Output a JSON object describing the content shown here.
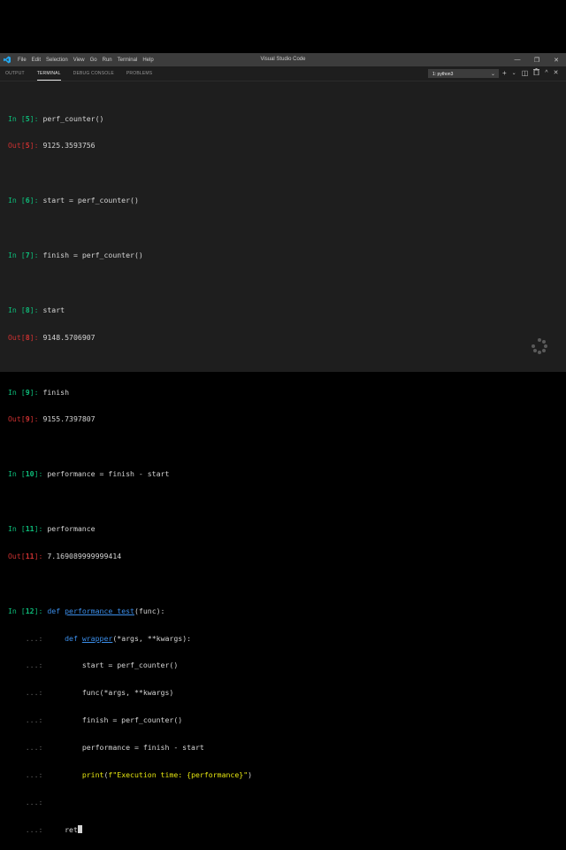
{
  "menu": [
    "File",
    "Edit",
    "Selection",
    "View",
    "Go",
    "Run",
    "Terminal",
    "Help"
  ],
  "app_title": "Visual Studio Code",
  "window_controls": {
    "minimize": "—",
    "restore": "❐",
    "close": "✕"
  },
  "panel_tabs": [
    {
      "label": "OUTPUT",
      "active": false
    },
    {
      "label": "TERMINAL",
      "active": true
    },
    {
      "label": "DEBUG CONSOLE",
      "active": false
    },
    {
      "label": "PROBLEMS",
      "active": false
    }
  ],
  "terminal_select": "1: python3",
  "panel_icons": [
    "plus-icon",
    "split-icon",
    "trash-icon",
    "chevron-up-icon",
    "close-icon"
  ],
  "terminal": {
    "l1_prompt": "In [",
    "l1_num": "5",
    "l1_end": "]: ",
    "l1_code": "perf_counter()",
    "o1_prompt": "Out[",
    "o1_num": "5",
    "o1_end": "]: ",
    "o1_val": "9125.3593756",
    "l2_prompt": "In [",
    "l2_num": "6",
    "l2_end": "]: ",
    "l2_code": "start = perf_counter()",
    "l3_prompt": "In [",
    "l3_num": "7",
    "l3_end": "]: ",
    "l3_code": "finish = perf_counter()",
    "l4_prompt": "In [",
    "l4_num": "8",
    "l4_end": "]: ",
    "l4_code": "start",
    "o4_prompt": "Out[",
    "o4_num": "8",
    "o4_end": "]: ",
    "o4_val": "9148.5706907",
    "l5_prompt": "In [",
    "l5_num": "9",
    "l5_end": "]: ",
    "l5_code": "finish",
    "o5_prompt": "Out[",
    "o5_num": "9",
    "o5_end": "]: ",
    "o5_val": "9155.7397807",
    "l6_prompt": "In [",
    "l6_num": "10",
    "l6_end": "]: ",
    "l6_code": "performance = finish - start",
    "l7_prompt": "In [",
    "l7_num": "11",
    "l7_end": "]: ",
    "l7_code": "performance",
    "o7_prompt": "Out[",
    "o7_num": "11",
    "o7_end": "]: ",
    "o7_val": "7.169089999999414",
    "l8_prompt": "In [",
    "l8_num": "12",
    "l8_end": "]: ",
    "l8_kw": "def",
    "l8_fn": "performance_test",
    "l8_rest": "(func):",
    "cont": "...:",
    "c1_kw": "def",
    "c1_fn": "wrapper",
    "c1_rest": "(*args, **kwargs):",
    "c2": "start = perf_counter()",
    "c3": "func(*args, **kwargs)",
    "c4": "finish = perf_counter()",
    "c5": "performance = finish - start",
    "c6_call": "print",
    "c6_open": "(",
    "c6_str": "f\"Execution time: {performance}\"",
    "c6_close": ")",
    "c8": "ret"
  }
}
